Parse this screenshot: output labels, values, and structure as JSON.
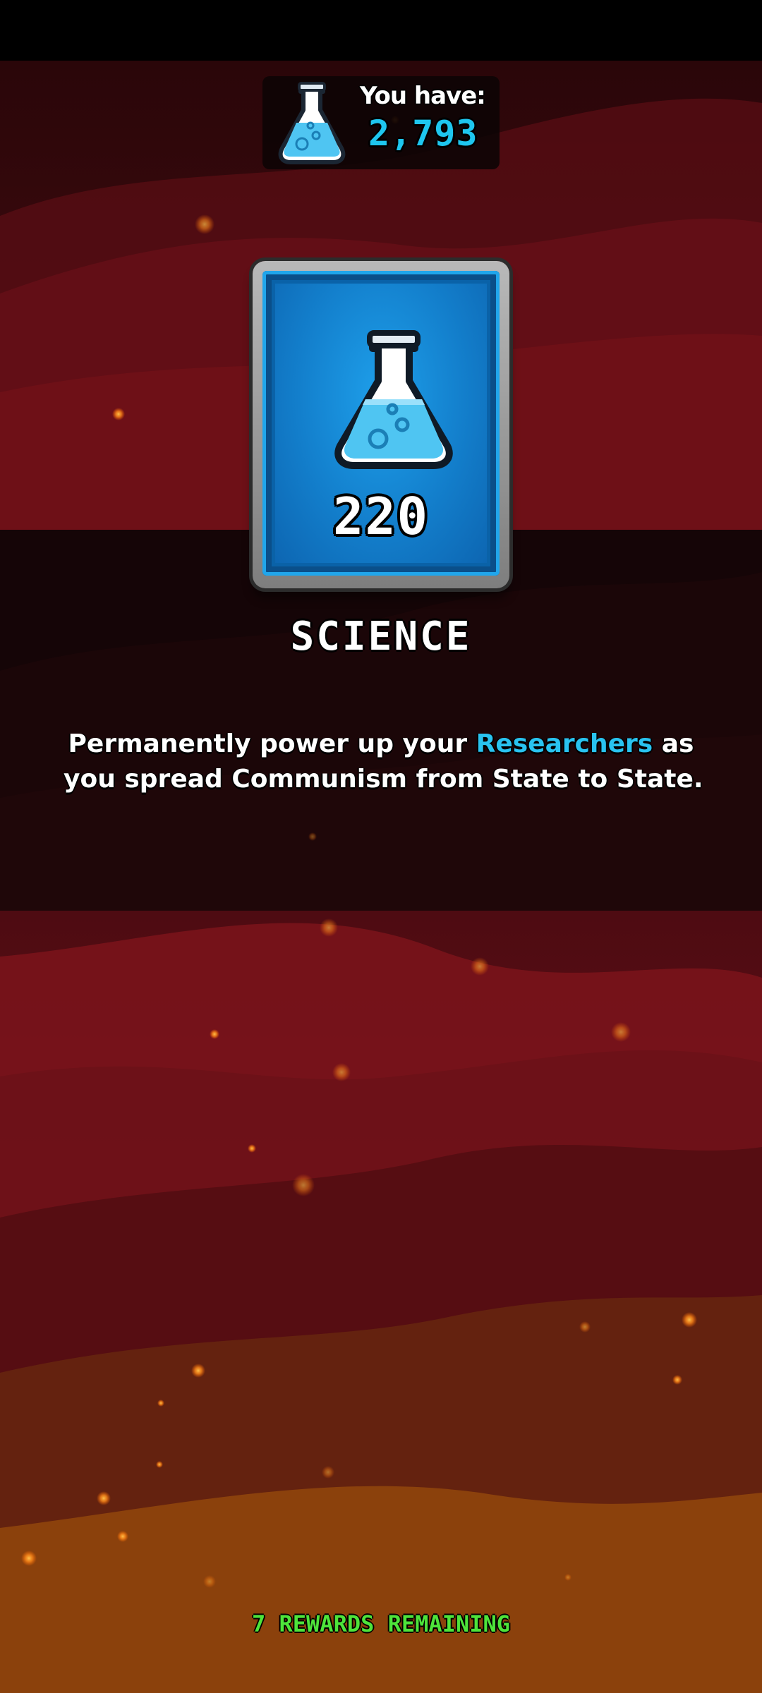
{
  "currency": {
    "label": "You have:",
    "value": "2,793",
    "icon": "science-flask-icon"
  },
  "reward": {
    "amount": "220",
    "title": "SCIENCE",
    "icon": "science-flask-icon",
    "description": {
      "line1_prefix": "Permanently power up your ",
      "line1_highlight": "Researchers",
      "line1_suffix": " as",
      "line2": "you spread Communism from State to State."
    }
  },
  "footer": {
    "remaining": "7 REWARDS REMAINING"
  },
  "colors": {
    "accent_blue": "#29c3f0",
    "remaining_green": "#4ee43a",
    "background_red": "#7a1419",
    "background_orange": "#c96a0c"
  }
}
